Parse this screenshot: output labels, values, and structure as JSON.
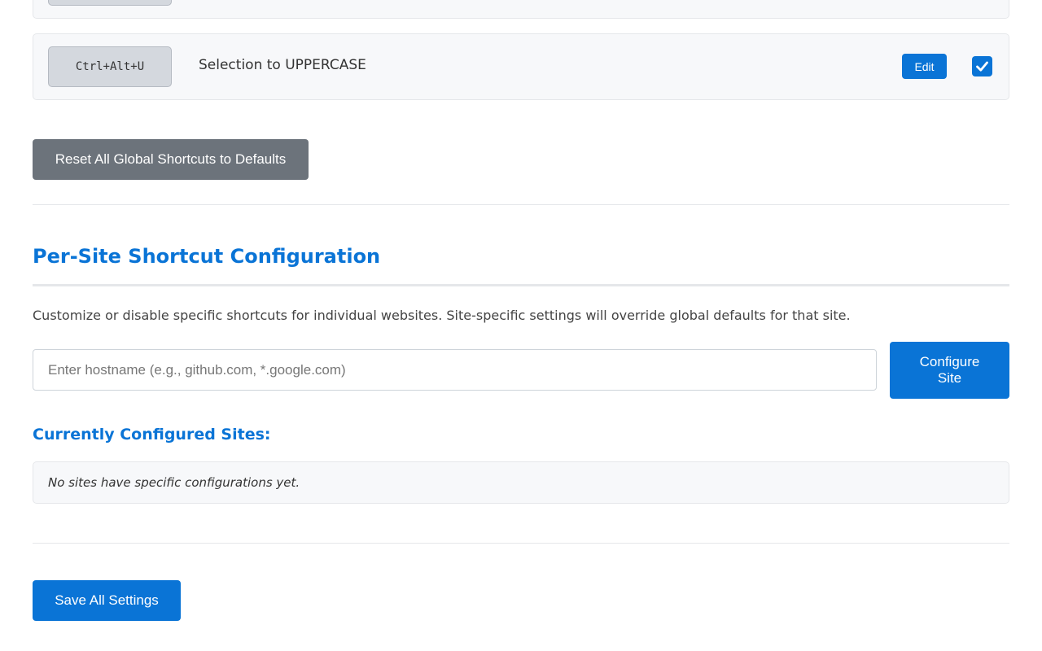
{
  "colors": {
    "accent": "#0a74d6",
    "secondary_button": "#6c737b",
    "row_background": "#f7f8fa",
    "border": "#e5e7ea",
    "keycap": "#d4d8de"
  },
  "global_shortcuts": {
    "rows": [
      {
        "keys": "Ctrl+Alt+U",
        "description": "Selection to UPPERCASE",
        "edit_label": "Edit",
        "enabled": true,
        "checkbox_icon": "checkmark-icon"
      }
    ],
    "reset_label": "Reset All Global Shortcuts to Defaults"
  },
  "per_site": {
    "title": "Per-Site Shortcut Configuration",
    "description": "Customize or disable specific shortcuts for individual websites. Site-specific settings will override global defaults for that site.",
    "hostname_input": {
      "placeholder": "Enter hostname (e.g., github.com, *.google.com)",
      "value": ""
    },
    "configure_label": "Configure Site",
    "configured_title": "Currently Configured Sites:",
    "empty_message": "No sites have specific configurations yet."
  },
  "footer": {
    "save_label": "Save All Settings"
  }
}
